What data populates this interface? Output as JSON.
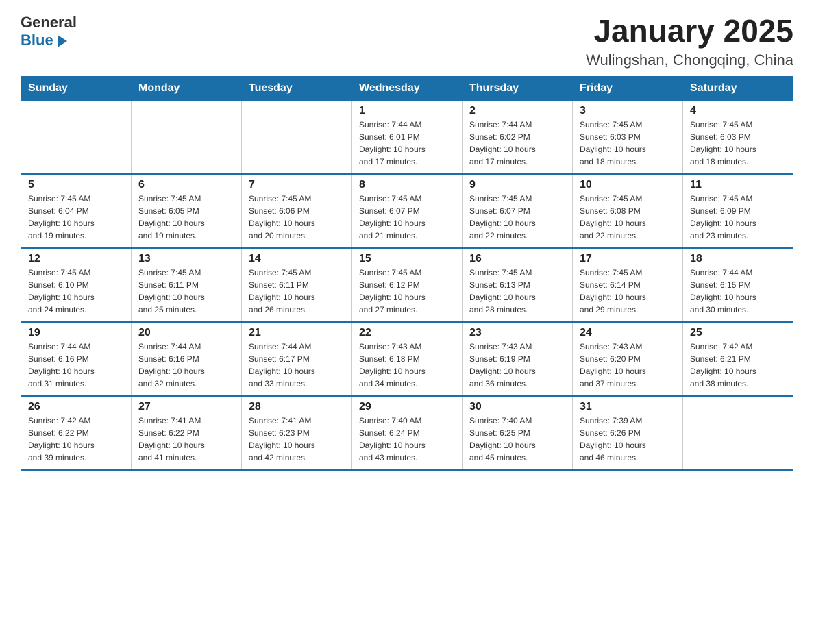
{
  "logo": {
    "general": "General",
    "blue": "Blue"
  },
  "title": "January 2025",
  "subtitle": "Wulingshan, Chongqing, China",
  "days_of_week": [
    "Sunday",
    "Monday",
    "Tuesday",
    "Wednesday",
    "Thursday",
    "Friday",
    "Saturday"
  ],
  "weeks": [
    [
      {
        "day": "",
        "info": ""
      },
      {
        "day": "",
        "info": ""
      },
      {
        "day": "",
        "info": ""
      },
      {
        "day": "1",
        "info": "Sunrise: 7:44 AM\nSunset: 6:01 PM\nDaylight: 10 hours\nand 17 minutes."
      },
      {
        "day": "2",
        "info": "Sunrise: 7:44 AM\nSunset: 6:02 PM\nDaylight: 10 hours\nand 17 minutes."
      },
      {
        "day": "3",
        "info": "Sunrise: 7:45 AM\nSunset: 6:03 PM\nDaylight: 10 hours\nand 18 minutes."
      },
      {
        "day": "4",
        "info": "Sunrise: 7:45 AM\nSunset: 6:03 PM\nDaylight: 10 hours\nand 18 minutes."
      }
    ],
    [
      {
        "day": "5",
        "info": "Sunrise: 7:45 AM\nSunset: 6:04 PM\nDaylight: 10 hours\nand 19 minutes."
      },
      {
        "day": "6",
        "info": "Sunrise: 7:45 AM\nSunset: 6:05 PM\nDaylight: 10 hours\nand 19 minutes."
      },
      {
        "day": "7",
        "info": "Sunrise: 7:45 AM\nSunset: 6:06 PM\nDaylight: 10 hours\nand 20 minutes."
      },
      {
        "day": "8",
        "info": "Sunrise: 7:45 AM\nSunset: 6:07 PM\nDaylight: 10 hours\nand 21 minutes."
      },
      {
        "day": "9",
        "info": "Sunrise: 7:45 AM\nSunset: 6:07 PM\nDaylight: 10 hours\nand 22 minutes."
      },
      {
        "day": "10",
        "info": "Sunrise: 7:45 AM\nSunset: 6:08 PM\nDaylight: 10 hours\nand 22 minutes."
      },
      {
        "day": "11",
        "info": "Sunrise: 7:45 AM\nSunset: 6:09 PM\nDaylight: 10 hours\nand 23 minutes."
      }
    ],
    [
      {
        "day": "12",
        "info": "Sunrise: 7:45 AM\nSunset: 6:10 PM\nDaylight: 10 hours\nand 24 minutes."
      },
      {
        "day": "13",
        "info": "Sunrise: 7:45 AM\nSunset: 6:11 PM\nDaylight: 10 hours\nand 25 minutes."
      },
      {
        "day": "14",
        "info": "Sunrise: 7:45 AM\nSunset: 6:11 PM\nDaylight: 10 hours\nand 26 minutes."
      },
      {
        "day": "15",
        "info": "Sunrise: 7:45 AM\nSunset: 6:12 PM\nDaylight: 10 hours\nand 27 minutes."
      },
      {
        "day": "16",
        "info": "Sunrise: 7:45 AM\nSunset: 6:13 PM\nDaylight: 10 hours\nand 28 minutes."
      },
      {
        "day": "17",
        "info": "Sunrise: 7:45 AM\nSunset: 6:14 PM\nDaylight: 10 hours\nand 29 minutes."
      },
      {
        "day": "18",
        "info": "Sunrise: 7:44 AM\nSunset: 6:15 PM\nDaylight: 10 hours\nand 30 minutes."
      }
    ],
    [
      {
        "day": "19",
        "info": "Sunrise: 7:44 AM\nSunset: 6:16 PM\nDaylight: 10 hours\nand 31 minutes."
      },
      {
        "day": "20",
        "info": "Sunrise: 7:44 AM\nSunset: 6:16 PM\nDaylight: 10 hours\nand 32 minutes."
      },
      {
        "day": "21",
        "info": "Sunrise: 7:44 AM\nSunset: 6:17 PM\nDaylight: 10 hours\nand 33 minutes."
      },
      {
        "day": "22",
        "info": "Sunrise: 7:43 AM\nSunset: 6:18 PM\nDaylight: 10 hours\nand 34 minutes."
      },
      {
        "day": "23",
        "info": "Sunrise: 7:43 AM\nSunset: 6:19 PM\nDaylight: 10 hours\nand 36 minutes."
      },
      {
        "day": "24",
        "info": "Sunrise: 7:43 AM\nSunset: 6:20 PM\nDaylight: 10 hours\nand 37 minutes."
      },
      {
        "day": "25",
        "info": "Sunrise: 7:42 AM\nSunset: 6:21 PM\nDaylight: 10 hours\nand 38 minutes."
      }
    ],
    [
      {
        "day": "26",
        "info": "Sunrise: 7:42 AM\nSunset: 6:22 PM\nDaylight: 10 hours\nand 39 minutes."
      },
      {
        "day": "27",
        "info": "Sunrise: 7:41 AM\nSunset: 6:22 PM\nDaylight: 10 hours\nand 41 minutes."
      },
      {
        "day": "28",
        "info": "Sunrise: 7:41 AM\nSunset: 6:23 PM\nDaylight: 10 hours\nand 42 minutes."
      },
      {
        "day": "29",
        "info": "Sunrise: 7:40 AM\nSunset: 6:24 PM\nDaylight: 10 hours\nand 43 minutes."
      },
      {
        "day": "30",
        "info": "Sunrise: 7:40 AM\nSunset: 6:25 PM\nDaylight: 10 hours\nand 45 minutes."
      },
      {
        "day": "31",
        "info": "Sunrise: 7:39 AM\nSunset: 6:26 PM\nDaylight: 10 hours\nand 46 minutes."
      },
      {
        "day": "",
        "info": ""
      }
    ]
  ]
}
